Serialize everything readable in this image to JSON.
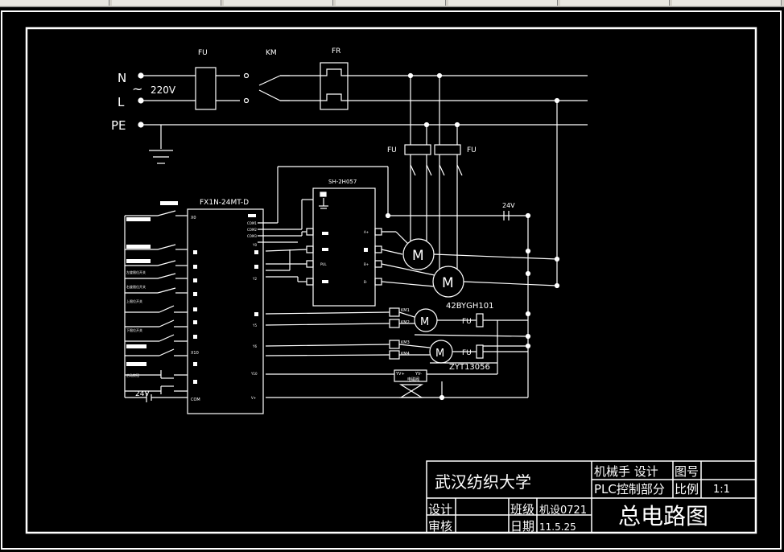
{
  "window": {
    "toolbar_segments": 7
  },
  "colors": {
    "background": "#000000",
    "line": "#ffffff",
    "frame": "#ffffff"
  },
  "labels": {
    "N": "N",
    "L": "L",
    "PE": "PE",
    "voltage": "220V",
    "ac_symbol": "~",
    "FU_main": "FU",
    "KM": "KM",
    "FR": "FR",
    "FU_left": "FU",
    "FU_right": "FU",
    "plc": "FX1N-24MT-D",
    "driver": "SH-2H057",
    "v24_top": "24V",
    "v24_bottom": "24V",
    "motor": "M",
    "stepper_model": "42BYGH101",
    "motor_model_2": "ZYT13056",
    "km1": "KM1",
    "km2": "KM2",
    "km3": "KM3",
    "km4": "KM4",
    "fu_m1": "FU",
    "fu_m2": "FU",
    "x0": "X0",
    "x10": "X10",
    "com": "COM",
    "com1": "COM1",
    "com2": "COM2",
    "com3": "COM3",
    "y0": "Y0",
    "y2": "Y2",
    "y4": "Y4",
    "y5": "Y5",
    "y6": "Y6",
    "y10": "Y10",
    "vplus": "V+",
    "d_a_plus": "A+",
    "d_a_minus": "A-",
    "d_b_plus": "B+",
    "d_b_minus": "B-",
    "d_pul": "PUL",
    "yv1": "YV+",
    "yv2": "YV-",
    "yv_caption": "电磁阀",
    "in_1": "左旋限位开关",
    "in_2": "右旋限位开关",
    "in_3": "上限位开关",
    "in_4": "下限位开关",
    "in_5": "启动按钮"
  },
  "title_block": {
    "school": "武汉纺织大学",
    "project": "机械手  设计",
    "part": "PLC控制部分",
    "drawing_no_label": "图号",
    "scale_label": "比例",
    "scale_value": "1:1",
    "design_label": "设计",
    "review_label": "审核",
    "class_label": "班级",
    "class_value": "机设0721",
    "date_label": "日期",
    "date_value": "11.5.25",
    "title": "总电路图"
  }
}
